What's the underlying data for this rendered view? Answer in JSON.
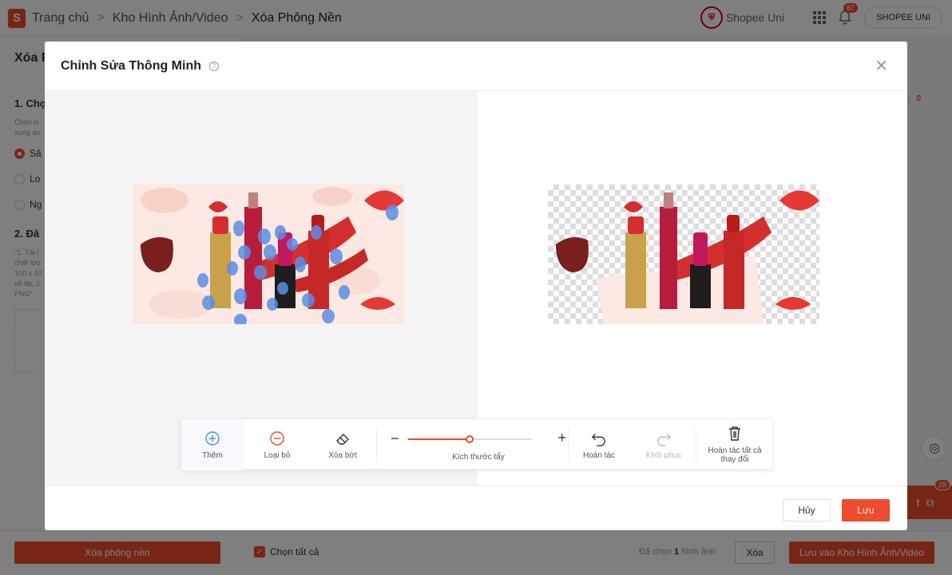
{
  "topbar": {
    "logo_letter": "S",
    "breadcrumb": [
      "Trang chủ",
      "Kho Hình Ảnh/Video"
    ],
    "current": "Xóa Phông Nền",
    "separator": ">",
    "uni_label": "Shopee Uni",
    "notification_count": "87",
    "shop_button": "SHOPEE UNI"
  },
  "background": {
    "page_title": "Xóa P",
    "step1": "1. Chọ",
    "step1_desc": "Chọn lo\nxung qu",
    "options": [
      "Sả",
      "Lo",
      "Ng"
    ],
    "step2": "2. Đă",
    "step2_desc": "\"1. Tải l\nchất lượ\n100 x 10\ntối đa: 2\nPNG\"",
    "right_label": "ống:",
    "right_count": "0"
  },
  "bottombar": {
    "remove_bg_label": "Xóa phông nền",
    "select_all_label": "Chọn tất cả",
    "selected_prefix": "Đã chọn",
    "selected_count": "1",
    "selected_suffix": "hình ảnh",
    "delete_label": "Xóa",
    "save_library_label": "Lưu vào Kho Hình Ảnh/Video"
  },
  "chat": {
    "badge": "28",
    "tab_text": "t"
  },
  "modal": {
    "title": "Chỉnh Sửa Thông Minh",
    "tools": {
      "add": "Thêm",
      "remove": "Loại bỏ",
      "erase": "Xóa bớt",
      "brush_size": "Kích thước tẩy",
      "undo": "Hoàn tác",
      "redo": "Khôi phục",
      "undo_all": "Hoàn tác tất cả thay đổi"
    },
    "brush_size_value": 0.5,
    "cancel_label": "Hủy",
    "save_label": "Lưu"
  },
  "colors": {
    "brand": "#ee4d2d",
    "add_blue": "#4f8ef7",
    "mask_blue": "#5b8ee6"
  }
}
